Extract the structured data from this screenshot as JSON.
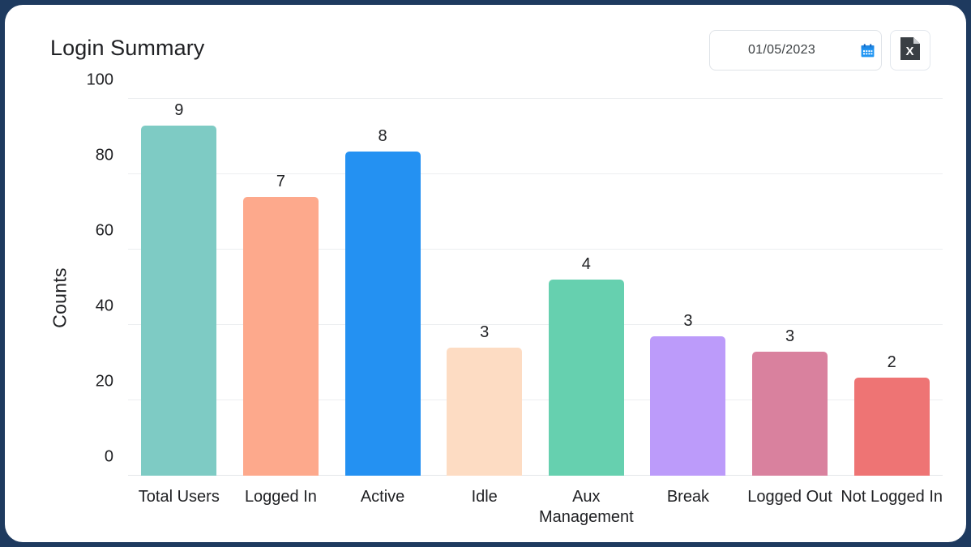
{
  "header": {
    "title": "Login Summary",
    "date_value": "01/05/2023",
    "calendar_icon": "calendar-icon",
    "export_icon": "excel-export-icon",
    "export_letter": "X"
  },
  "chart_data": {
    "type": "bar",
    "title": "Login Summary",
    "xlabel": "",
    "ylabel": "Counts",
    "categories": [
      "Total Users",
      "Logged In",
      "Active",
      "Idle",
      "Aux Management",
      "Break",
      "Logged Out",
      "Not Logged In"
    ],
    "values": [
      9,
      7,
      8,
      3,
      4,
      3,
      3,
      2
    ],
    "bar_heights_axis": [
      93,
      74,
      86,
      34,
      52,
      37,
      33,
      26
    ],
    "colors": [
      "#7ECBC4",
      "#FDA98C",
      "#2491F2",
      "#FDDCC3",
      "#66D0AF",
      "#BC9BFA",
      "#D9819E",
      "#EE7474"
    ],
    "yticks": [
      0,
      20,
      40,
      60,
      80,
      100
    ],
    "ylim": [
      0,
      100
    ],
    "grid": true,
    "legend": "none"
  },
  "theme": {
    "card_bg": "#ffffff",
    "page_bg": "#1e3a5f",
    "text": "#202124",
    "accent": "#2491F2",
    "gridline": "#eceef0"
  }
}
